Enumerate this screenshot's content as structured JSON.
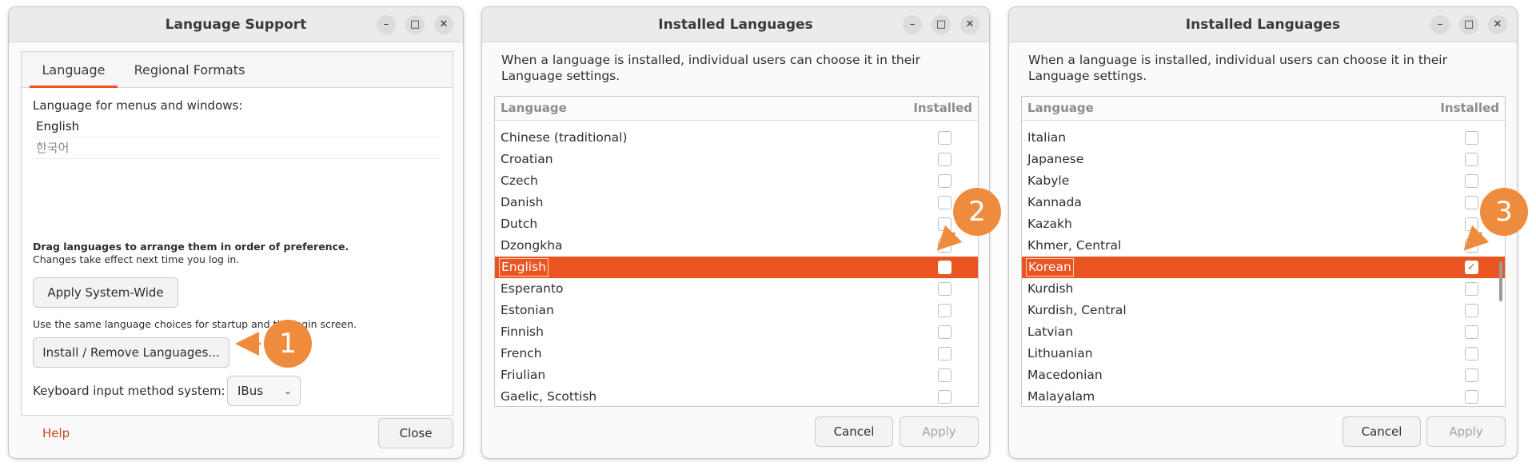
{
  "window1": {
    "title": "Language Support",
    "tabs": [
      "Language",
      "Regional Formats"
    ],
    "menus_label": "Language for menus and windows:",
    "languages": [
      "English",
      "한국어"
    ],
    "drag_hint": "Drag languages to arrange them in order of preference.",
    "changes_hint": "Changes take effect next time you log in.",
    "apply_system_wide": "Apply System-Wide",
    "startup_hint": "Use the same language choices for startup and the login screen.",
    "install_remove": "Install / Remove Languages...",
    "keyboard_label": "Keyboard input method system:",
    "keyboard_value": "IBus",
    "help": "Help",
    "close": "Close"
  },
  "window2": {
    "title": "Installed Languages",
    "intro": "When a language is installed, individual users can choose it in their Language settings.",
    "col_language": "Language",
    "col_installed": "Installed",
    "rows": [
      "Chinese (traditional)",
      "Croatian",
      "Czech",
      "Danish",
      "Dutch",
      "Dzongkha",
      "English",
      "Esperanto",
      "Estonian",
      "Finnish",
      "French",
      "Friulian",
      "Gaelic, Scottish"
    ],
    "selected_index": 6,
    "cancel": "Cancel",
    "apply": "Apply"
  },
  "window3": {
    "title": "Installed Languages",
    "intro": "When a language is installed, individual users can choose it in their Language settings.",
    "col_language": "Language",
    "col_installed": "Installed",
    "rows": [
      "Italian",
      "Japanese",
      "Kabyle",
      "Kannada",
      "Kazakh",
      "Khmer, Central",
      "Korean",
      "Kurdish",
      "Kurdish, Central",
      "Latvian",
      "Lithuanian",
      "Macedonian",
      "Malayalam"
    ],
    "selected_index": 6,
    "checked_index": 6,
    "cancel": "Cancel",
    "apply": "Apply"
  },
  "callouts": [
    "1",
    "2",
    "3"
  ],
  "colors": {
    "accent": "#e95420",
    "callout": "#ef8b3d",
    "link": "#c7471b"
  },
  "icons": {
    "minimize": "minimize-icon",
    "maximize": "maximize-icon",
    "close": "close-icon",
    "checkmark": "checkmark-icon"
  }
}
